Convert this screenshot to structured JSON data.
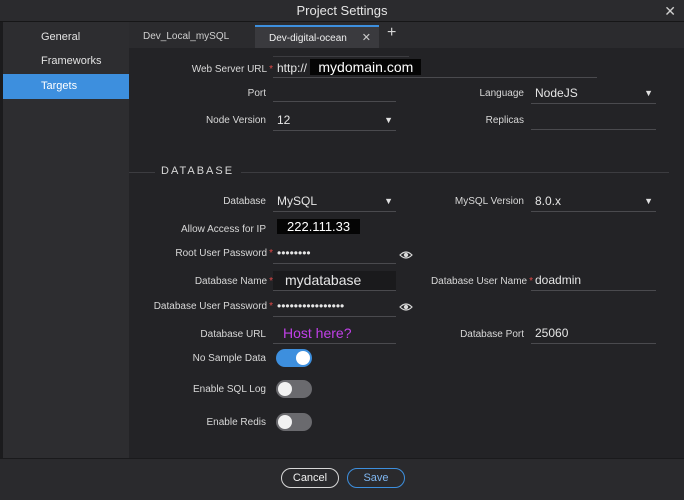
{
  "window": {
    "title": "Project Settings"
  },
  "sidebar": {
    "items": [
      {
        "label": "General"
      },
      {
        "label": "Frameworks"
      },
      {
        "label": "Targets"
      }
    ]
  },
  "tabs": [
    {
      "label": "Dev_Local_mySQL"
    },
    {
      "label": "Dev-digital-ocean"
    }
  ],
  "server": {
    "web_server_url_label": "Web Server URL",
    "web_server_url_prefix": "http://",
    "web_server_url_value": "mydomain.com",
    "port_label": "Port",
    "port_value": "",
    "language_label": "Language",
    "language_value": "NodeJS",
    "node_version_label": "Node Version",
    "node_version_value": "12",
    "replicas_label": "Replicas",
    "replicas_value": ""
  },
  "database": {
    "section_title": "DATABASE",
    "database_label": "Database",
    "database_value": "MySQL",
    "mysql_version_label": "MySQL Version",
    "mysql_version_value": "8.0.x",
    "allow_access_label": "Allow Access for IP",
    "allow_access_value": "222.111.33",
    "root_password_label": "Root User Password",
    "root_password_value": "••••••••",
    "db_name_label": "Database Name",
    "db_name_value": "mydatabase",
    "db_user_name_label": "Database User Name",
    "db_user_name_value": "doadmin",
    "db_user_password_label": "Database User Password",
    "db_user_password_value": "••••••••••••••••",
    "db_url_label": "Database URL",
    "db_url_value": "Host here?",
    "db_port_label": "Database Port",
    "db_port_value": "25060",
    "no_sample_label": "No Sample Data",
    "no_sample_on": true,
    "sql_log_label": "Enable SQL Log",
    "sql_log_on": false,
    "redis_label": "Enable Redis",
    "redis_on": false
  },
  "footer": {
    "cancel_label": "Cancel",
    "save_label": "Save"
  },
  "icons": {
    "close": "close-icon",
    "add_tab": "plus-icon",
    "dropdown": "chevron-down-icon",
    "eye": "eye-icon"
  },
  "colors": {
    "accent": "#3d8fde",
    "required": "#e04848",
    "annotation": "#c040e8"
  }
}
